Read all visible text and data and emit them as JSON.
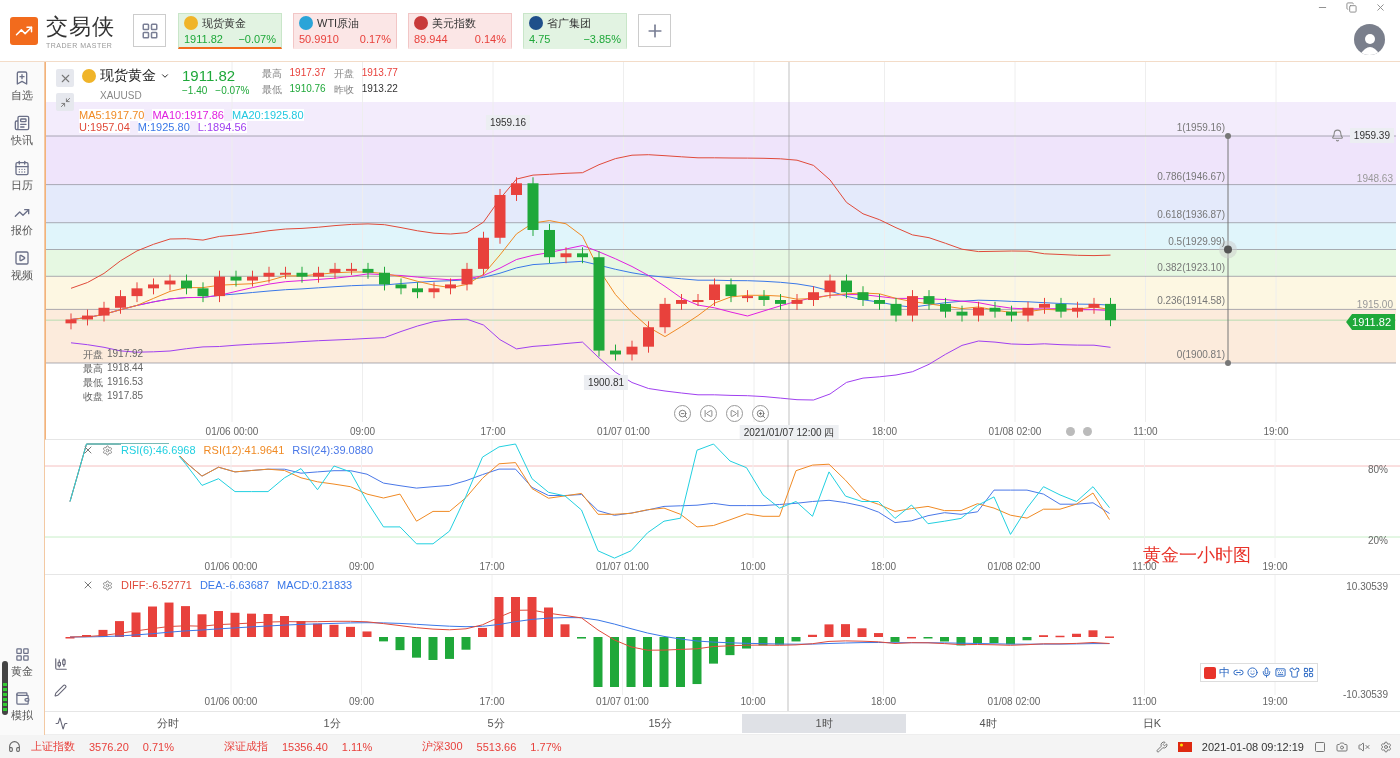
{
  "app": {
    "name": "交易侠",
    "subtitle": "TRADER MASTER"
  },
  "tickers": [
    {
      "name": "现货黄金",
      "price": "1911.82",
      "change": "−0.07%",
      "up": false,
      "selected": true,
      "color": "#f0b429"
    },
    {
      "name": "WTI原油",
      "price": "50.9910",
      "change": "0.17%",
      "up": true,
      "selected": false,
      "color": "#2aa4d8"
    },
    {
      "name": "美元指数",
      "price": "89.944",
      "change": "0.14%",
      "up": true,
      "selected": false,
      "color": "#c83a3a"
    },
    {
      "name": "省广集团",
      "price": "4.75",
      "change": "−3.85%",
      "up": false,
      "selected": false,
      "color": "#1f4f8a"
    }
  ],
  "sidebar": {
    "items": [
      {
        "label": "自选"
      },
      {
        "label": "快讯"
      },
      {
        "label": "日历"
      },
      {
        "label": "报价"
      },
      {
        "label": "视频"
      }
    ],
    "bottom_items": [
      {
        "label": "黄金"
      },
      {
        "label": "模拟"
      }
    ]
  },
  "quote": {
    "name": "现货黄金",
    "code": "XAUUSD",
    "price": "1911.82",
    "change": "−1.40",
    "change_pct": "−0.07%",
    "up": false,
    "stats": [
      {
        "label": "最高",
        "value": "1917.37",
        "up": true
      },
      {
        "label": "开盘",
        "value": "1913.77",
        "up": true
      },
      {
        "label": "最低",
        "value": "1910.76",
        "up": false
      },
      {
        "label": "昨收",
        "value": "1913.22"
      }
    ]
  },
  "main_chart": {
    "ma_legend": [
      {
        "label": "MA5:1917.70",
        "color": "#f08a24"
      },
      {
        "label": "MA10:1917.86",
        "color": "#e020e0"
      },
      {
        "label": "MA20:1925.80",
        "color": "#22c8e0"
      }
    ],
    "boll_legend": [
      {
        "label": "U:1957.04",
        "color": "#e04a3a"
      },
      {
        "label": "M:1925.80",
        "color": "#3a78e8"
      },
      {
        "label": "L:1894.56",
        "color": "#a040f0"
      }
    ],
    "peak_label": "1959.16",
    "trough_label": "1900.81",
    "ohlc": [
      {
        "label": "开盘",
        "value": "1917.92"
      },
      {
        "label": "最高",
        "value": "1918.44"
      },
      {
        "label": "最低",
        "value": "1916.53"
      },
      {
        "label": "收盘",
        "value": "1917.85"
      }
    ],
    "fib_levels": [
      {
        "label": "1(1959.16)",
        "color": "#f3ecfc"
      },
      {
        "label": "0.786(1946.67)",
        "color": "#efe4fb"
      },
      {
        "label": "0.618(1936.87)",
        "color": "#e4eafb"
      },
      {
        "label": "0.5(1929.99)",
        "color": "#e0f5fb"
      },
      {
        "label": "0.382(1923.10)",
        "color": "#e6f8e2"
      },
      {
        "label": "0.236(1914.58)",
        "color": "#fdf7e2"
      },
      {
        "label": "0(1900.81)",
        "color": "#fcebdc"
      }
    ],
    "alert_price": "1959.39",
    "side_prices": [
      "1948.63",
      "1915.00"
    ],
    "current_price": "1911.82",
    "crosshair_label": "2021/01/07 12:00 四",
    "x_labels_before_crosshair": [
      "01/06 00:00",
      "09:00",
      "17:00",
      "01/07 01:00"
    ],
    "x_labels_after_crosshair": [
      "18:00",
      "01/08 02:00",
      "11:00",
      "19:00"
    ]
  },
  "rsi": {
    "legend": [
      {
        "label": "RSI(6):46.6968",
        "color": "#22d0e0"
      },
      {
        "label": "RSI(12):41.9641",
        "color": "#f08a24"
      },
      {
        "label": "RSI(24):39.0880",
        "color": "#4a78e8"
      }
    ],
    "levels": [
      "80%",
      "20%"
    ],
    "x_labels": [
      "01/06 00:00",
      "09:00",
      "17:00",
      "01/07 01:00",
      "10:00",
      "18:00",
      "01/08 02:00",
      "11:00",
      "19:00"
    ],
    "annotation": "黄金一小时图"
  },
  "macd": {
    "legend": [
      {
        "label": "DIFF:-6.52771",
        "color": "#e04a3a"
      },
      {
        "label": "DEA:-6.63687",
        "color": "#3a78e8"
      },
      {
        "label": "MACD:0.21833",
        "color": "#3a78e8"
      }
    ],
    "top_value": "10.30539",
    "bottom_value": "-10.30539",
    "x_labels": [
      "01/06 00:00",
      "09:00",
      "17:00",
      "01/07 01:00",
      "10:00",
      "18:00",
      "01/08 02:00",
      "11:00",
      "19:00"
    ],
    "ime_label": "中"
  },
  "periods": [
    {
      "label": "分时",
      "selected": false
    },
    {
      "label": "1分",
      "selected": false
    },
    {
      "label": "5分",
      "selected": false
    },
    {
      "label": "15分",
      "selected": false
    },
    {
      "label": "1时",
      "selected": true
    },
    {
      "label": "4时",
      "selected": false
    },
    {
      "label": "日K",
      "selected": false
    }
  ],
  "status_bar": {
    "indices": [
      {
        "name": "上证指数",
        "value": "3576.20",
        "pct": "0.71%",
        "up": true
      },
      {
        "name": "深证成指",
        "value": "15356.40",
        "pct": "1.11%",
        "up": true
      },
      {
        "name": "沪深300",
        "value": "5513.66",
        "pct": "1.77%",
        "up": true
      }
    ],
    "datetime": "2021-01-08 09:12:19"
  }
}
